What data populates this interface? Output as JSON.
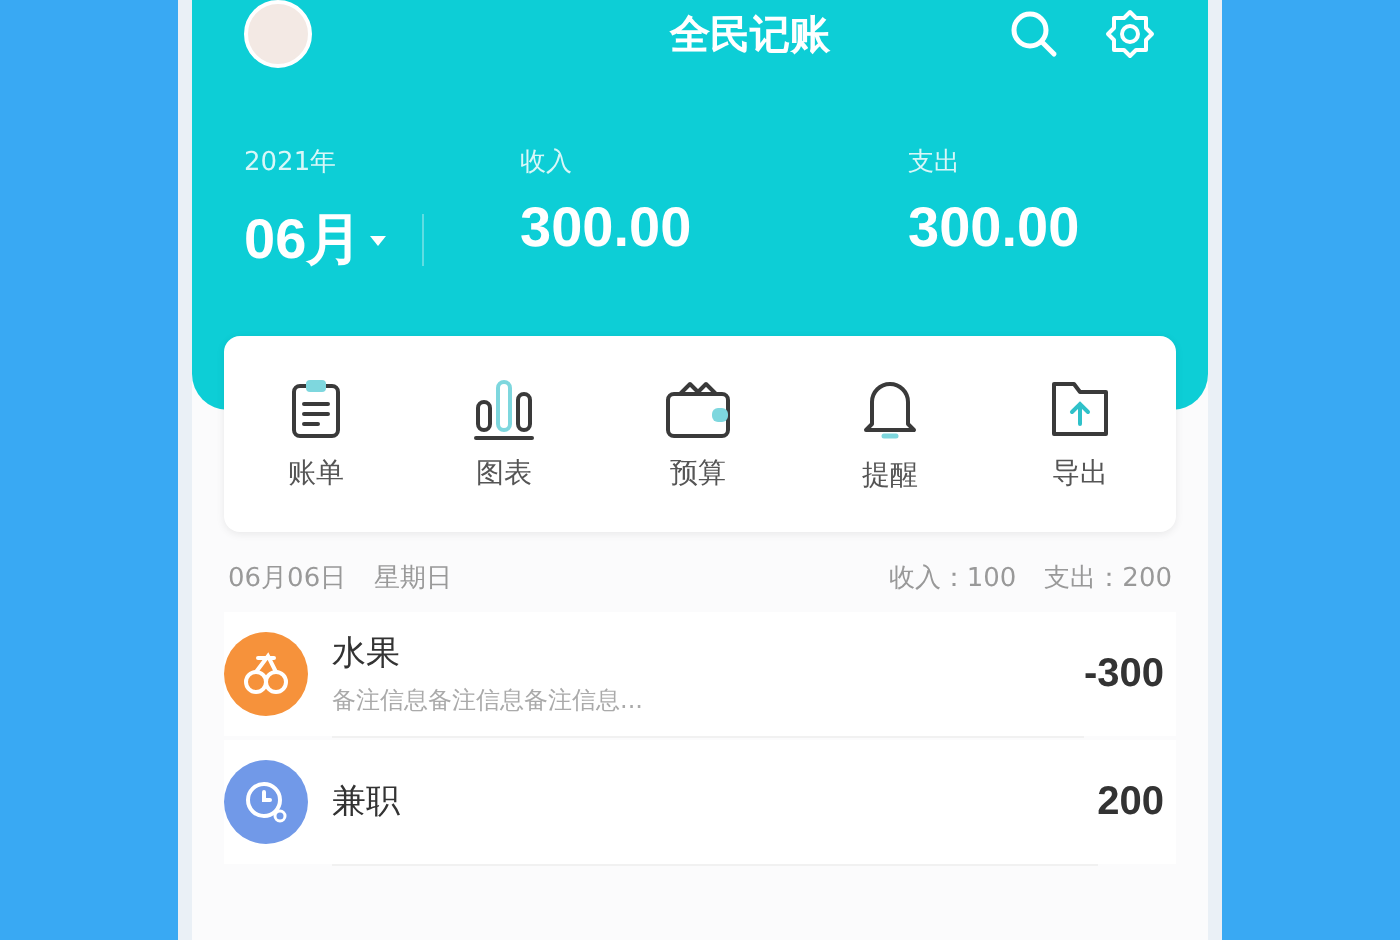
{
  "header": {
    "title": "全民记账"
  },
  "summary": {
    "year": "2021年",
    "month": "06月",
    "income_label": "收入",
    "income": "300.00",
    "expense_label": "支出",
    "expense": "300.00"
  },
  "actions": [
    {
      "label": "账单",
      "kind": "bill"
    },
    {
      "label": "图表",
      "kind": "chart"
    },
    {
      "label": "预算",
      "kind": "wallet"
    },
    {
      "label": "提醒",
      "kind": "bell"
    },
    {
      "label": "导出",
      "kind": "export"
    }
  ],
  "day": {
    "date": "06月06日",
    "weekday": "星期日",
    "income": "收入：100",
    "expense": "支出：200"
  },
  "records": [
    {
      "category": "水果",
      "note": "备注信息备注信息备注信息...",
      "amount": "-300",
      "color": "#f6923b",
      "kind": "fruit"
    },
    {
      "category": "兼职",
      "amount": "200",
      "color": "#7199e8",
      "kind": "clock"
    }
  ]
}
